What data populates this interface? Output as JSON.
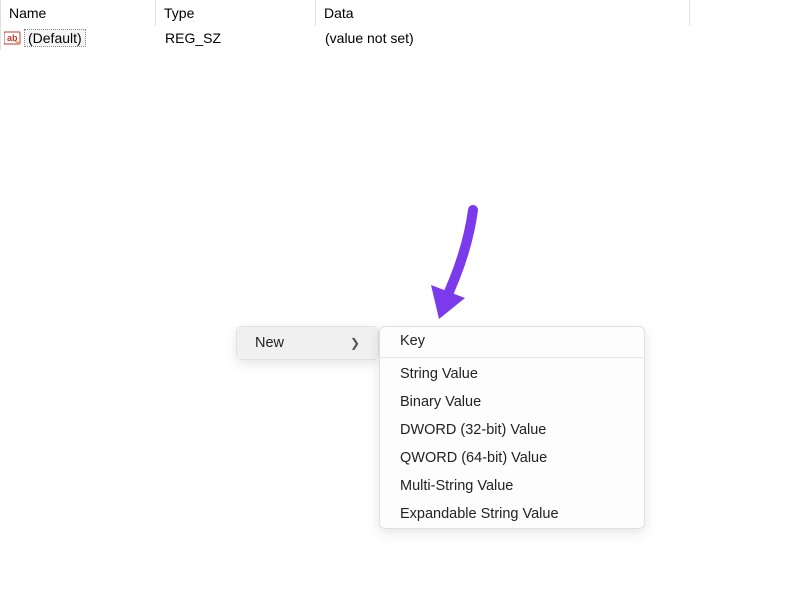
{
  "table": {
    "headers": {
      "name": "Name",
      "type": "Type",
      "data": "Data"
    },
    "rows": [
      {
        "name": "(Default)",
        "type": "REG_SZ",
        "data": "(value not set)"
      }
    ]
  },
  "context_menu": {
    "new_label": "New",
    "submenu": {
      "key": "Key",
      "string_value": "String Value",
      "binary_value": "Binary Value",
      "dword_value": "DWORD (32-bit) Value",
      "qword_value": "QWORD (64-bit) Value",
      "multi_string_value": "Multi-String Value",
      "expandable_string_value": "Expandable String Value"
    }
  },
  "annotation": {
    "arrow_color": "#7c3aed"
  }
}
